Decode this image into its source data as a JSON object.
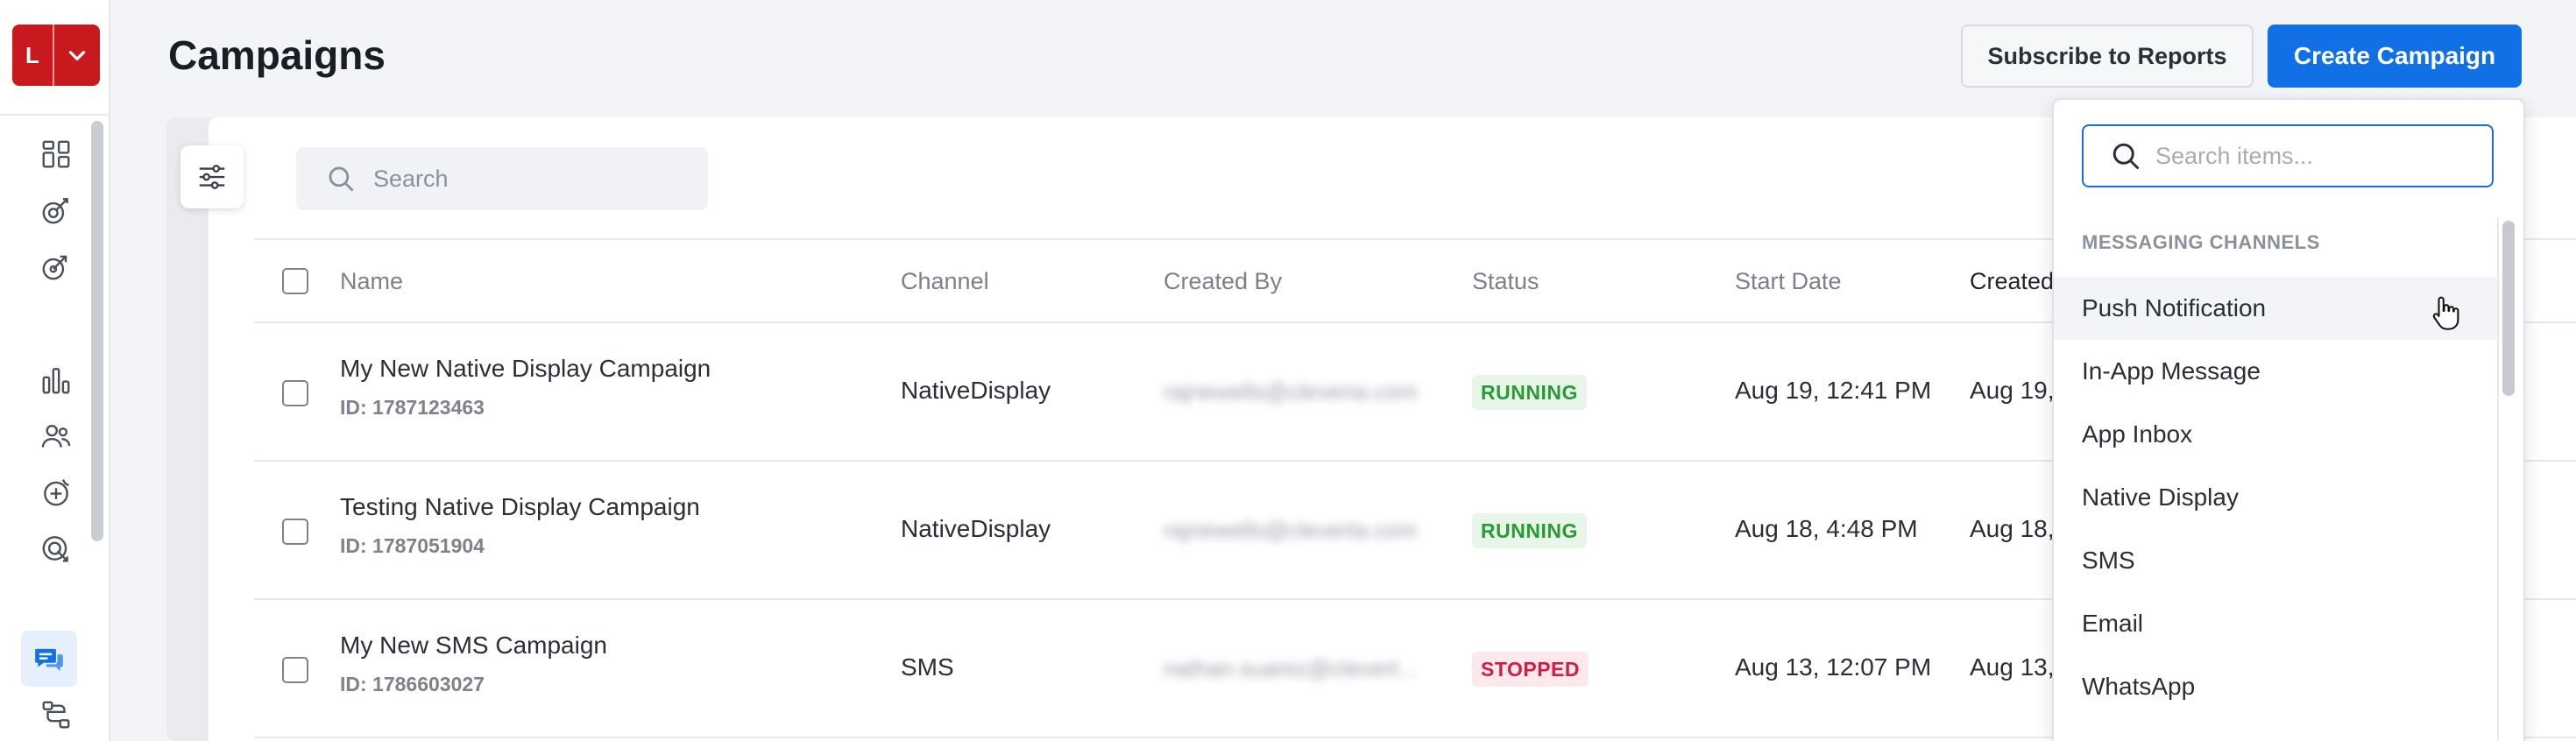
{
  "app": {
    "logo_letter": "L",
    "brand_color": "#c8191e",
    "accent_color": "#1270e6"
  },
  "rail": {
    "icons": [
      "dashboard-icon",
      "campaigns-icon",
      "journeys-icon",
      "analytics-icon",
      "users-icon",
      "segments-icon",
      "targeting-icon",
      "messages-icon",
      "flows-icon"
    ],
    "active": "messages-icon"
  },
  "header": {
    "title": "Campaigns",
    "subscribe_label": "Subscribe to Reports",
    "create_label": "Create Campaign"
  },
  "toolbar": {
    "search_placeholder": "Search"
  },
  "table": {
    "columns": [
      "Name",
      "Channel",
      "Created By",
      "Status",
      "Start Date",
      "Created"
    ],
    "rows": [
      {
        "name": "My New Native Display Campaign",
        "id": "ID: 1787123463",
        "channel": "NativeDisplay",
        "created_by": "rajnewells@cleverta.com",
        "status": "RUNNING",
        "start_date": "Aug 19, 12:41 PM",
        "created": "Aug 19,"
      },
      {
        "name": "Testing Native Display Campaign",
        "id": "ID: 1787051904",
        "channel": "NativeDisplay",
        "created_by": "rajnewells@cleverta.com",
        "status": "RUNNING",
        "start_date": "Aug 18, 4:48 PM",
        "created": "Aug 18,"
      },
      {
        "name": "My New SMS Campaign",
        "id": "ID: 1786603027",
        "channel": "SMS",
        "created_by": "nathan.suarez@clevert...",
        "status": "STOPPED",
        "start_date": "Aug 13, 12:07 PM",
        "created": "Aug 13,"
      }
    ],
    "status_colors": {
      "RUNNING": "#2a9a35",
      "STOPPED": "#d31b45"
    }
  },
  "dropdown": {
    "search_placeholder": "Search items...",
    "section_title": "MESSAGING CHANNELS",
    "items": [
      "Push Notification",
      "In-App Message",
      "App Inbox",
      "Native Display",
      "SMS",
      "Email",
      "WhatsApp"
    ],
    "hovered": "Push Notification"
  }
}
